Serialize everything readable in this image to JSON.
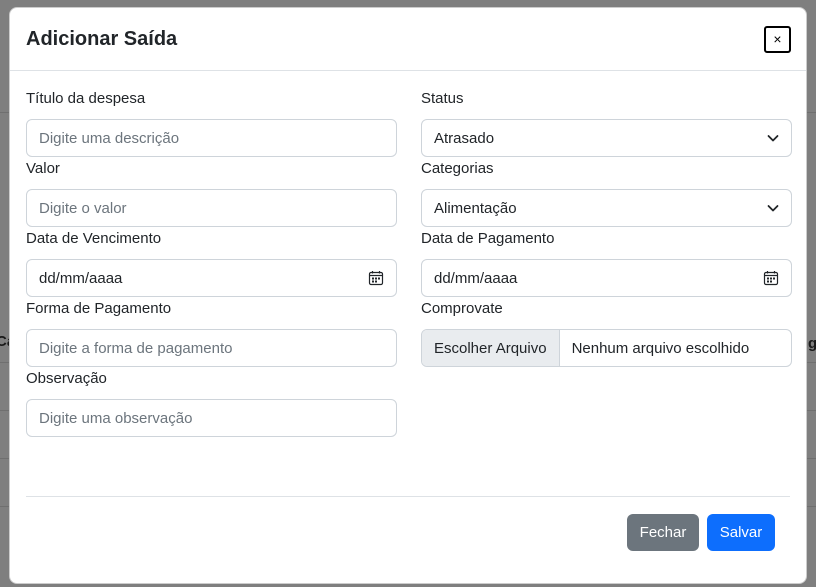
{
  "modal": {
    "title": "Adicionar Saída",
    "close_label": "×"
  },
  "form": {
    "titulo": {
      "label": "Título da despesa",
      "placeholder": "Digite uma descrição"
    },
    "valor": {
      "label": "Valor",
      "placeholder": "Digite o valor"
    },
    "vencimento": {
      "label": "Data de Vencimento",
      "value": "dd/mm/aaaa"
    },
    "forma_pagamento": {
      "label": "Forma de Pagamento",
      "placeholder": "Digite a forma de pagamento"
    },
    "observacao": {
      "label": "Observação",
      "placeholder": "Digite uma observação"
    },
    "status": {
      "label": "Status",
      "value": "Atrasado"
    },
    "categorias": {
      "label": "Categorias",
      "value": "Alimentação"
    },
    "pagamento": {
      "label": "Data de Pagamento",
      "value": "dd/mm/aaaa"
    },
    "comprovante": {
      "label": "Comprovate",
      "button": "Escolher Arquivo",
      "file_status": "Nenhum arquivo escolhido"
    }
  },
  "footer": {
    "close_label": "Fechar",
    "save_label": "Salvar"
  },
  "background": {
    "left_fragment": "Ca",
    "right_fragment": "g"
  }
}
